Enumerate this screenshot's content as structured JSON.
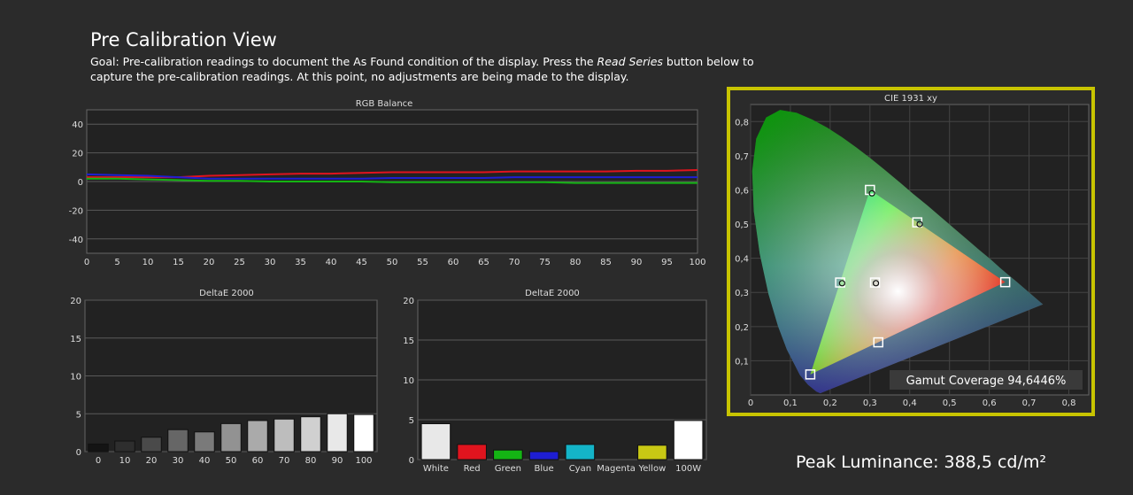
{
  "page": {
    "title": "Pre Calibration View",
    "goal_prefix": "Goal: Pre-calibration readings to document the As Found condition of the display. Press the ",
    "goal_emphasis": "Read Series",
    "goal_suffix": " button below to capture the pre-calibration readings. At this point, no adjustments are being made to the display.",
    "peak_luminance": "Peak Luminance: 388,5 cd/m²"
  },
  "colors": {
    "background": "#2b2b2b",
    "plot_bg": "#222222",
    "accent_frame": "#c8c400",
    "red": "#e0141e",
    "green": "#14b414",
    "blue": "#1e1ed2"
  },
  "chart_data": [
    {
      "id": "rgb",
      "type": "line",
      "title": "RGB Balance",
      "x": [
        0,
        5,
        10,
        15,
        20,
        25,
        30,
        35,
        40,
        45,
        50,
        55,
        60,
        65,
        70,
        75,
        80,
        85,
        90,
        95,
        100
      ],
      "xlim": [
        0,
        100
      ],
      "ylim": [
        -50,
        50
      ],
      "yticks": [
        40,
        20,
        0,
        -20,
        -40
      ],
      "grid": true,
      "series": [
        {
          "color": "#e0141e",
          "values": [
            3,
            3,
            3,
            3,
            4,
            4.5,
            5,
            5.5,
            5.5,
            6,
            6.5,
            6.5,
            6.5,
            6.5,
            7,
            7,
            7,
            7,
            7.5,
            7.5,
            8
          ]
        },
        {
          "color": "#1e1ed2",
          "values": [
            5,
            4.5,
            4,
            3,
            2,
            2,
            2,
            2,
            2,
            2,
            2.5,
            2.5,
            2.5,
            2.5,
            3,
            3,
            3,
            3,
            3,
            3,
            3
          ]
        },
        {
          "color": "#14b414",
          "values": [
            2,
            2,
            1.5,
            1,
            0.5,
            0.5,
            0,
            0,
            0,
            0,
            -0.5,
            -0.5,
            -0.5,
            -0.5,
            -0.5,
            -0.5,
            -1,
            -1,
            -1,
            -1,
            -1
          ]
        }
      ]
    },
    {
      "id": "grey",
      "type": "bar",
      "title": "DeltaE 2000",
      "categories": [
        "0",
        "10",
        "20",
        "30",
        "40",
        "50",
        "60",
        "70",
        "80",
        "90",
        "100"
      ],
      "values": [
        1.0,
        1.4,
        1.9,
        2.9,
        2.6,
        3.7,
        4.1,
        4.3,
        4.6,
        5.0,
        4.9
      ],
      "colors": [
        "#141414",
        "#2e2e2e",
        "#4a4a4a",
        "#666666",
        "#7a7a7a",
        "#929292",
        "#aaaaaa",
        "#bdbdbd",
        "#d0d0d0",
        "#e8e8e8",
        "#ffffff"
      ],
      "ylim": [
        0,
        20
      ],
      "yticks": [
        20,
        15,
        10,
        5,
        0
      ]
    },
    {
      "id": "color",
      "type": "bar",
      "title": "DeltaE 2000",
      "categories": [
        "White",
        "Red",
        "Green",
        "Blue",
        "Cyan",
        "Magenta",
        "Yellow",
        "100W"
      ],
      "values": [
        4.5,
        1.9,
        1.2,
        1.0,
        1.9,
        0,
        1.8,
        4.9
      ],
      "colors": [
        "#e8e8e8",
        "#e0141e",
        "#14b414",
        "#1e1ed2",
        "#14b4c8",
        "#c814c8",
        "#c8c814",
        "#ffffff"
      ],
      "ylim": [
        0,
        20
      ],
      "yticks": [
        20,
        15,
        10,
        5,
        0
      ]
    },
    {
      "id": "cie",
      "type": "scatter",
      "title": "CIE 1931 xy",
      "xlim": [
        0,
        0.85
      ],
      "ylim": [
        0,
        0.85
      ],
      "xticks": [
        "0",
        "0,1",
        "0,2",
        "0,3",
        "0,4",
        "0,5",
        "0,6",
        "0,7",
        "0,8"
      ],
      "yticks": [
        "0,8",
        "0,7",
        "0,6",
        "0,5",
        "0,4",
        "0,3",
        "0,2",
        "0,1"
      ],
      "targets": [
        {
          "x": 0.64,
          "y": 0.33
        },
        {
          "x": 0.3,
          "y": 0.6
        },
        {
          "x": 0.15,
          "y": 0.06
        },
        {
          "x": 0.225,
          "y": 0.329
        },
        {
          "x": 0.321,
          "y": 0.154
        },
        {
          "x": 0.419,
          "y": 0.505
        },
        {
          "x": 0.3127,
          "y": 0.329
        }
      ],
      "measured": [
        {
          "x": 0.305,
          "y": 0.59
        },
        {
          "x": 0.23,
          "y": 0.327
        },
        {
          "x": 0.425,
          "y": 0.5
        },
        {
          "x": 0.315,
          "y": 0.327
        }
      ],
      "gamut_coverage": "Gamut Coverage 94,6446%"
    }
  ]
}
